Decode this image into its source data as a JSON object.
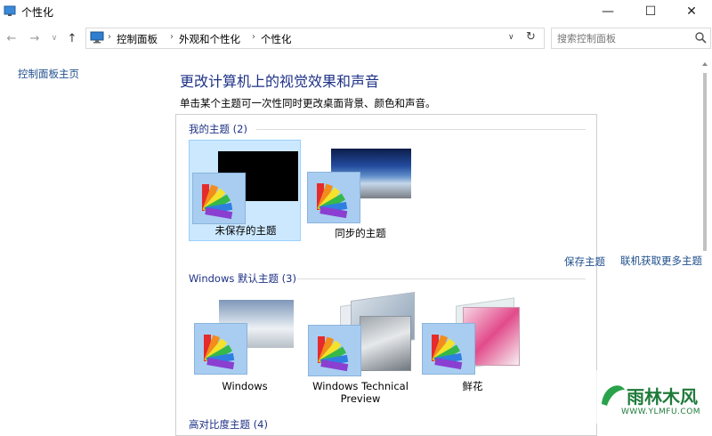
{
  "window": {
    "title": "个性化",
    "minimize_glyph": "—",
    "maximize_glyph": "☐",
    "close_glyph": "✕"
  },
  "nav": {
    "back_glyph": "←",
    "forward_glyph": "→",
    "dropdown_glyph": "∨",
    "up_glyph": "↑",
    "breadcrumb": [
      "控制面板",
      "外观和个性化",
      "个性化"
    ],
    "separator": "›",
    "address_dropdown_glyph": "∨",
    "refresh_glyph": "↻"
  },
  "search": {
    "placeholder": "搜索控制面板"
  },
  "sidebar": {
    "home_link": "控制面板主页"
  },
  "main": {
    "heading": "更改计算机上的视觉效果和声音",
    "subtitle": "单击某个主题可一次性同时更改桌面背景、颜色和声音。",
    "my_themes": {
      "title": "我的主题 (2)",
      "items": [
        {
          "label": "未保存的主题",
          "selected": true
        },
        {
          "label": "同步的主题",
          "selected": false
        }
      ],
      "save_link": "保存主题",
      "more_link": "联机获取更多主题"
    },
    "default_themes": {
      "title": "Windows 默认主题 (3)",
      "items": [
        {
          "label": "Windows"
        },
        {
          "label_line1": "Windows Technical",
          "label_line2": "Preview"
        },
        {
          "label": "鲜花"
        }
      ]
    },
    "high_contrast": {
      "title": "高对比度主题 (4)"
    }
  },
  "watermark": {
    "brand": "雨林木风",
    "url": "WWW.YLMFU.COM"
  },
  "colors": {
    "heading_blue": "#1e3287",
    "link_blue": "#1e4e8c",
    "selection_bg": "#cce8ff",
    "selection_border": "#99d1ff"
  }
}
